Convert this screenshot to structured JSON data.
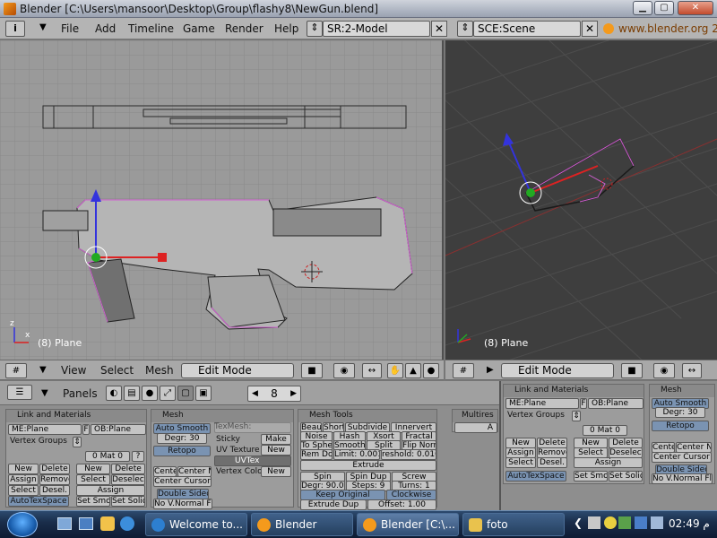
{
  "window": {
    "title": "Blender [C:\\Users\\mansoor\\Desktop\\Group\\flashy8\\NewGun.blend]"
  },
  "menu": {
    "items": [
      "File",
      "Add",
      "Timeline",
      "Game",
      "Render",
      "Help"
    ],
    "screen_field": "SR:2-Model",
    "scene_field": "SCE:Scene",
    "url": "www.blender.org 2"
  },
  "viewport_left": {
    "label": "(8) Plane"
  },
  "viewport_right": {
    "label": "(8) Plane"
  },
  "left_header": {
    "items": [
      "View",
      "Select",
      "Mesh"
    ],
    "mode": "Edit Mode"
  },
  "right_header": {
    "mode": "Edit Mode"
  },
  "buttons_header": {
    "panels_label": "Panels",
    "frame_value": "8"
  },
  "link_panel": {
    "title": "Link and Materials",
    "me_field": "ME:Plane",
    "f_label": "F",
    "ob_field": "OB:Plane",
    "vertex_groups": "Vertex Groups",
    "mat_value": "0 Mat 0",
    "q_btn": "?",
    "new": "New",
    "delete": "Delete",
    "assign": "Assign",
    "remove": "Remove",
    "select": "Select",
    "desel": "Desel.",
    "new2": "New",
    "delete2": "Delete",
    "select2": "Select",
    "deselect2": "Deselect",
    "assign2": "Assign",
    "autotexspace": "AutoTexSpace",
    "set_smo": "Set Smo",
    "set_solid": "Set Solid"
  },
  "mesh_panel": {
    "title": "Mesh",
    "auto_smooth": "Auto Smooth",
    "degr": "Degr: 30",
    "retopo": "Retopo",
    "center": "Cente",
    "center_new": "Center Ne",
    "center_cursor": "Center Cursor",
    "double_sided": "Double Sided",
    "no_vnormal": "No V.Normal Fli",
    "texmesh": "TexMesh:",
    "sticky": "Sticky",
    "make": "Make",
    "uv_texture": "UV Texture",
    "new": "New",
    "uvtex": "UVTex",
    "vertex_color": "Vertex Color",
    "new2": "New"
  },
  "mesh_tools": {
    "title": "Mesh Tools",
    "row1": [
      "Beaut",
      "Short",
      "Subdivide",
      "Innervert"
    ],
    "row2": [
      "Noise",
      "Hash",
      "Xsort",
      "Fractal"
    ],
    "row3": [
      "To Spher",
      "Smooth",
      "Split",
      "Flip Norm"
    ],
    "row4": [
      "Rem Dou",
      "Limit: 0.001",
      "reshold: 0.010"
    ],
    "extrude": "Extrude",
    "row5": [
      "Spin",
      "Spin Dup",
      "Screw"
    ],
    "row6": [
      "Degr: 90.00",
      "Steps: 9",
      "Turns: 1"
    ],
    "keep_original": "Keep Original",
    "clockwise": "Clockwise",
    "extrude_dup": "Extrude Dup",
    "offset": "Offset: 1.00"
  },
  "multires": {
    "title": "Multires",
    "add": "A"
  },
  "right_link_panel": {
    "title": "Link and Materials",
    "me_field": "ME:Plane",
    "f_label": "F",
    "ob_field": "OB:Plane",
    "vertex_groups": "Vertex Groups",
    "mat_value": "0 Mat 0",
    "new": "New",
    "delete": "Delete",
    "assign": "Assign",
    "remove": "Remove",
    "select": "Select",
    "desel": "Desel.",
    "new2": "New",
    "delete2": "Delete",
    "select2": "Select",
    "deselect2": "Deselect",
    "assign2": "Assign",
    "autotexspace": "AutoTexSpace",
    "set_smo": "Set Smo",
    "set_solid": "Set Solid"
  },
  "right_mesh_panel": {
    "title": "Mesh",
    "auto_smooth": "Auto Smooth",
    "degr": "Degr: 30",
    "retopo": "Retopo",
    "center": "Cente",
    "center_new": "Center Ne",
    "center_cursor": "Center Cursor",
    "double_sided": "Double Sided",
    "no_vnormal": "No V.Normal Fli"
  },
  "taskbar": {
    "tasks": [
      "Welcome to...",
      "Blender",
      "Blender [C:\\...",
      "foto"
    ],
    "clock": "02:49 م"
  },
  "colors": {
    "accent": "#f49a1c",
    "selected_edge": "#d060d0",
    "taskbar": "#1a2e4b"
  }
}
